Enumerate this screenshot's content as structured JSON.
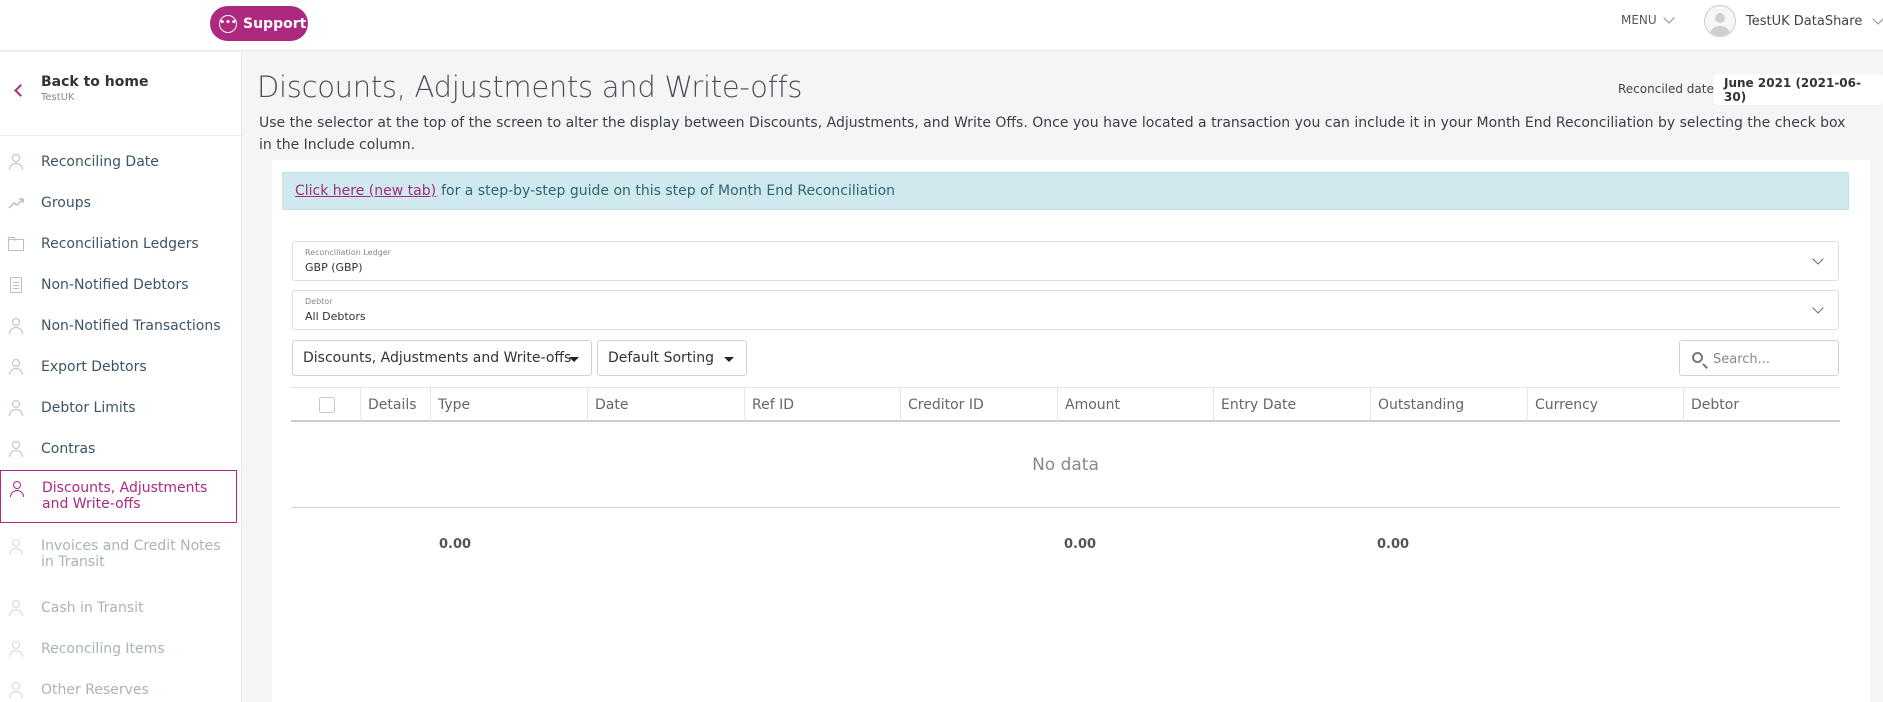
{
  "topbar": {
    "support_label": "Support",
    "menu_label": "MENU",
    "user_name": "TestUK DataShare"
  },
  "sidebar": {
    "back_title": "Back to home",
    "back_subtitle": "TestUK",
    "items": [
      {
        "label": "Reconciling Date",
        "icon": "person-icon",
        "state": "normal"
      },
      {
        "label": "Groups",
        "icon": "trend-icon",
        "state": "normal"
      },
      {
        "label": "Reconciliation Ledgers",
        "icon": "folder-icon",
        "state": "normal"
      },
      {
        "label": "Non-Notified Debtors",
        "icon": "document-icon",
        "state": "normal"
      },
      {
        "label": "Non-Notified Transactions",
        "icon": "person-icon",
        "state": "normal"
      },
      {
        "label": "Export Debtors",
        "icon": "person-icon",
        "state": "normal"
      },
      {
        "label": "Debtor Limits",
        "icon": "person-icon",
        "state": "normal"
      },
      {
        "label": "Contras",
        "icon": "person-icon",
        "state": "normal"
      },
      {
        "label": "Discounts, Adjustments and Write-offs",
        "icon": "person-icon",
        "state": "active"
      },
      {
        "label": "Invoices and Credit Notes in Transit",
        "icon": "person-icon",
        "state": "disabled"
      },
      {
        "label": "Cash in Transit",
        "icon": "person-icon",
        "state": "disabled"
      },
      {
        "label": "Reconciling Items",
        "icon": "person-icon",
        "state": "disabled"
      },
      {
        "label": "Other Reserves",
        "icon": "person-icon",
        "state": "disabled"
      }
    ]
  },
  "main": {
    "title": "Discounts, Adjustments and Write-offs",
    "reconciled_label": "Reconciled date",
    "reconciled_value": "June 2021 (2021-06-30)",
    "description": "Use the selector at the top of the screen to alter the display between Discounts, Adjustments, and Write Offs. Once you have located a transaction you can include it in your Month End Reconciliation by selecting the check box in the Include column.",
    "banner_link": "Click here (new tab)",
    "banner_text": "for a step-by-step guide on this step of Month End Reconciliation",
    "ledger_label": "Reconciliation Ledger",
    "ledger_value": "GBP (GBP)",
    "debtor_label": "Debtor",
    "debtor_value": "All Debtors",
    "type_filter": "Discounts, Adjustments and Write-offs",
    "sort_filter": "Default Sorting",
    "search_placeholder": "Search..."
  },
  "table": {
    "columns": [
      "Details",
      "Type",
      "Date",
      "Ref ID",
      "Creditor ID",
      "Amount",
      "Entry Date",
      "Outstanding",
      "Currency",
      "Debtor"
    ],
    "empty_text": "No data",
    "totals": [
      "0.00",
      "0.00",
      "0.00"
    ]
  },
  "colors": {
    "accent": "#ad287f",
    "banner_bg": "#cfe9ee",
    "nav_text": "#3d5466",
    "nav_disabled": "#a9b3bb"
  }
}
